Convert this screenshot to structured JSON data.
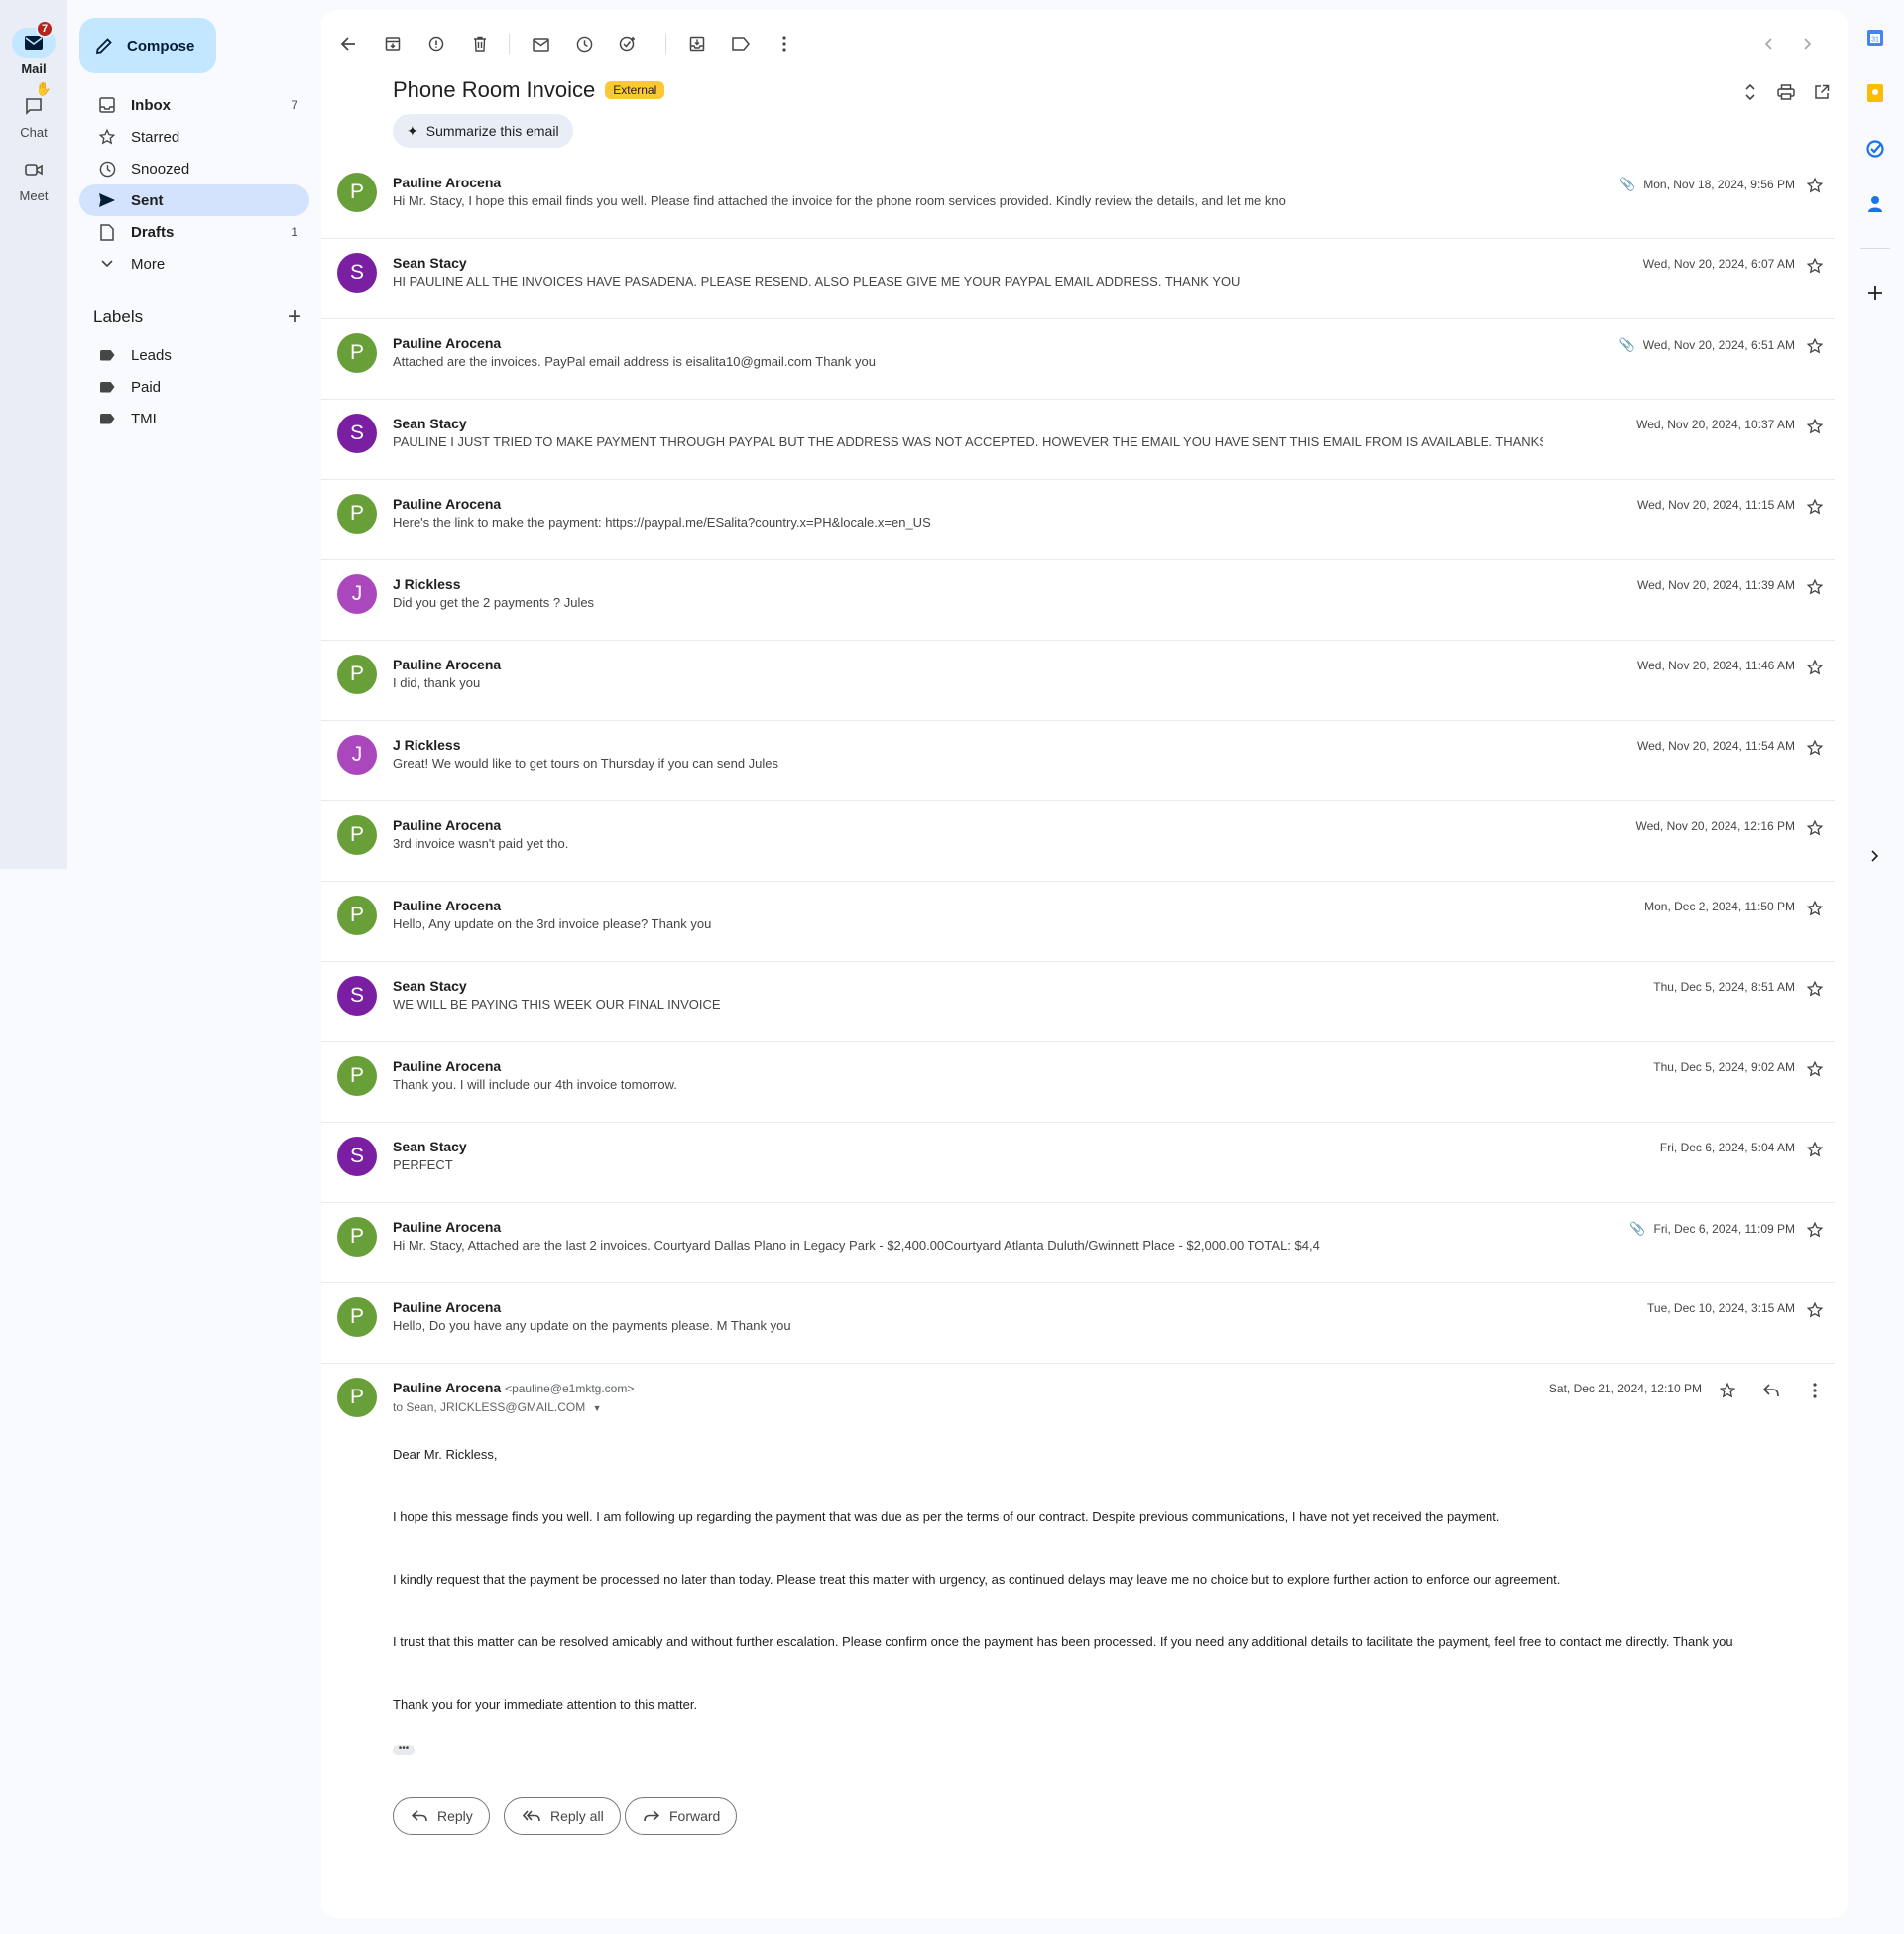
{
  "rail": {
    "mail_label": "Mail",
    "mail_badge": "7",
    "chat_label": "Chat",
    "meet_label": "Meet"
  },
  "compose_label": "Compose",
  "nav": {
    "inbox": {
      "label": "Inbox",
      "count": "7"
    },
    "starred": {
      "label": "Starred"
    },
    "snoozed": {
      "label": "Snoozed"
    },
    "sent": {
      "label": "Sent"
    },
    "drafts": {
      "label": "Drafts",
      "count": "1"
    },
    "more": {
      "label": "More"
    }
  },
  "labels": {
    "heading": "Labels",
    "items": [
      "Leads",
      "Paid",
      "TMI"
    ]
  },
  "thread": {
    "subject": "Phone Room Invoice",
    "external_badge": "External",
    "summarize_label": "Summarize this email"
  },
  "messages": [
    {
      "initial": "P",
      "color": "#689f38",
      "sender": "Pauline Arocena",
      "snippet": "Hi Mr. Stacy, I hope this email finds you well. Please find attached the invoice for the phone room services provided. Kindly review the details, and let me kno",
      "date": "Mon, Nov 18, 2024, 9:56 PM",
      "attachment": true
    },
    {
      "initial": "S",
      "color": "#7b1fa2",
      "sender": "Sean Stacy",
      "snippet": "HI PAULINE ALL THE INVOICES HAVE PASADENA. PLEASE RESEND. ALSO PLEASE GIVE ME YOUR PAYPAL EMAIL ADDRESS. THANK YOU",
      "date": "Wed, Nov 20, 2024, 6:07 AM",
      "attachment": false
    },
    {
      "initial": "P",
      "color": "#689f38",
      "sender": "Pauline Arocena",
      "snippet": "Attached are the invoices. PayPal email address is eisalita10@gmail.com Thank you",
      "date": "Wed, Nov 20, 2024, 6:51 AM",
      "attachment": true
    },
    {
      "initial": "S",
      "color": "#7b1fa2",
      "sender": "Sean Stacy",
      "snippet": "PAULINE I JUST TRIED TO MAKE PAYMENT THROUGH PAYPAL BUT THE ADDRESS WAS NOT ACCEPTED. HOWEVER THE EMAIL YOU HAVE SENT THIS EMAIL FROM IS AVAILABLE. THANKS",
      "date": "Wed, Nov 20, 2024, 10:37 AM",
      "attachment": false
    },
    {
      "initial": "P",
      "color": "#689f38",
      "sender": "Pauline Arocena",
      "snippet": "Here's the link to make the payment: https://paypal.me/ESalita?country.x=PH&locale.x=en_US",
      "date": "Wed, Nov 20, 2024, 11:15 AM",
      "attachment": false
    },
    {
      "initial": "J",
      "color": "#ab47bc",
      "sender": "J Rickless",
      "snippet": "Did you get the 2 payments ? Jules",
      "date": "Wed, Nov 20, 2024, 11:39 AM",
      "attachment": false
    },
    {
      "initial": "P",
      "color": "#689f38",
      "sender": "Pauline Arocena",
      "snippet": "I did, thank you",
      "date": "Wed, Nov 20, 2024, 11:46 AM",
      "attachment": false
    },
    {
      "initial": "J",
      "color": "#ab47bc",
      "sender": "J Rickless",
      "snippet": "Great! We would like to get tours on Thursday if you can send Jules",
      "date": "Wed, Nov 20, 2024, 11:54 AM",
      "attachment": false
    },
    {
      "initial": "P",
      "color": "#689f38",
      "sender": "Pauline Arocena",
      "snippet": "3rd invoice wasn't paid yet tho.",
      "date": "Wed, Nov 20, 2024, 12:16 PM",
      "attachment": false
    },
    {
      "initial": "P",
      "color": "#689f38",
      "sender": "Pauline Arocena",
      "snippet": "Hello, Any update on the 3rd invoice please? Thank you",
      "date": "Mon, Dec 2, 2024, 11:50 PM",
      "attachment": false
    },
    {
      "initial": "S",
      "color": "#7b1fa2",
      "sender": "Sean Stacy",
      "snippet": "WE WILL BE PAYING THIS WEEK OUR FINAL INVOICE",
      "date": "Thu, Dec 5, 2024, 8:51 AM",
      "attachment": false
    },
    {
      "initial": "P",
      "color": "#689f38",
      "sender": "Pauline Arocena",
      "snippet": "Thank you. I will include our 4th invoice tomorrow.",
      "date": "Thu, Dec 5, 2024, 9:02 AM",
      "attachment": false
    },
    {
      "initial": "S",
      "color": "#7b1fa2",
      "sender": "Sean Stacy",
      "snippet": "PERFECT",
      "date": "Fri, Dec 6, 2024, 5:04 AM",
      "attachment": false
    },
    {
      "initial": "P",
      "color": "#689f38",
      "sender": "Pauline Arocena",
      "snippet": "Hi Mr. Stacy, Attached are the last 2 invoices. Courtyard Dallas Plano in Legacy Park - $2,400.00Courtyard Atlanta Duluth/Gwinnett Place - $2,000.00 TOTAL: $4,4",
      "date": "Fri, Dec 6, 2024, 11:09 PM",
      "attachment": true
    },
    {
      "initial": "P",
      "color": "#689f38",
      "sender": "Pauline Arocena",
      "snippet": "Hello, Do you have any update on the payments please. M Thank you",
      "date": "Tue, Dec 10, 2024, 3:15 AM",
      "attachment": false
    }
  ],
  "expanded": {
    "initial": "P",
    "color": "#689f38",
    "sender": "Pauline Arocena",
    "email": "<pauline@e1mktg.com>",
    "to": "to Sean, JRICKLESS@GMAIL.COM",
    "date": "Sat, Dec 21, 2024, 12:10 PM",
    "body": [
      "Dear Mr. Rickless,",
      "I hope this message finds you well. I am following up regarding the payment that was due as per the terms of our contract. Despite previous communications, I have not yet received the payment.",
      "I kindly request that the payment be processed no later than today. Please treat this matter with urgency, as continued delays may leave me no choice but to explore further action to enforce our agreement.",
      "I trust that this matter can be resolved amicably and without further escalation. Please confirm once the payment has been processed. If you need any additional details to facilitate the payment, feel free to contact me directly. Thank you",
      "Thank you for your immediate attention to this matter."
    ]
  },
  "actions": {
    "reply": "Reply",
    "reply_all": "Reply all",
    "forward": "Forward"
  },
  "colors": {
    "accent": "#c2e7ff",
    "external_badge": "#fcc934",
    "sent_active": "#d3e3fd"
  }
}
